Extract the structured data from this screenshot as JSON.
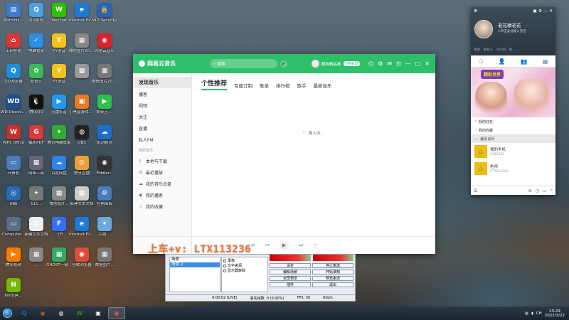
{
  "desktop": {
    "icons": [
      {
        "label": "Adminis...",
        "glyph": "▤",
        "color": "#3d7ac9"
      },
      {
        "label": "QQ游戏",
        "glyph": "Q",
        "color": "#4aa0e0"
      },
      {
        "label": "WeChat",
        "glyph": "W",
        "color": "#2dc100"
      },
      {
        "label": "Internet Explorer",
        "glyph": "e",
        "color": "#1f7ad6"
      },
      {
        "label": "WD Security",
        "glyph": "🔒",
        "color": "#2a65b5"
      },
      {
        "label": "上网导航",
        "glyph": "⌂",
        "color": "#d93636"
      },
      {
        "label": "电脑管家",
        "glyph": "✓",
        "color": "#2a8ee8"
      },
      {
        "label": "YY语音",
        "glyph": "Y",
        "color": "#f4c21c"
      },
      {
        "label": "微信图片20210...",
        "glyph": "▦",
        "color": "#888"
      },
      {
        "label": "网易云音乐",
        "glyph": "◉",
        "color": "#d9232b"
      },
      {
        "label": "QQ浏览器",
        "glyph": "Q",
        "color": "#1e8ed8"
      },
      {
        "label": "爱奇艺",
        "glyph": "✿",
        "color": "#3cba54"
      },
      {
        "label": "YY语音",
        "glyph": "Y",
        "color": "#f4c21c"
      },
      {
        "label": "...",
        "glyph": "▦",
        "color": "#999"
      },
      {
        "label": "微信图片2021...",
        "glyph": "▦",
        "color": "#777"
      },
      {
        "label": "WD Discovery",
        "glyph": "WD",
        "color": "#1f4f8e"
      },
      {
        "label": "腾讯QQ",
        "glyph": "🐧",
        "color": "#111"
      },
      {
        "label": "迅雷影音",
        "glyph": "▶",
        "color": "#2196f3"
      },
      {
        "label": "小黑盒游戏助手",
        "glyph": "▣",
        "color": "#e87a22"
      },
      {
        "label": "爱奇艺 ...",
        "glyph": "▶",
        "color": "#2fc04f"
      },
      {
        "label": "WPS Office",
        "glyph": "W",
        "color": "#c5322d"
      },
      {
        "label": "福昕PDF",
        "glyph": "G",
        "color": "#d83b3b"
      },
      {
        "label": "腾讯电脑管家",
        "glyph": "✦",
        "color": "#3a3"
      },
      {
        "label": "OBS",
        "glyph": "◍",
        "color": "#222"
      },
      {
        "label": "驱动精灵",
        "glyph": "☁",
        "color": "#1d6fcf"
      },
      {
        "label": "计算机",
        "glyph": "▭",
        "color": "#4b7bb8"
      },
      {
        "label": "网络工具",
        "glyph": "▦",
        "color": "#667"
      },
      {
        "label": "百度网盘",
        "glyph": "☁",
        "color": "#2f83e4"
      },
      {
        "label": "虎牙直播",
        "glyph": "◎",
        "color": "#e9a03a"
      },
      {
        "label": "Fiddler...",
        "glyph": "◉",
        "color": "#333"
      },
      {
        "label": "网络",
        "glyph": "◎",
        "color": "#2b6ab5"
      },
      {
        "label": "111...",
        "glyph": "✦",
        "color": "#777"
      },
      {
        "label": "微信图片...",
        "glyph": "▦",
        "color": "#888"
      },
      {
        "label": "新建文本文档",
        "glyph": "▦",
        "color": "#ccc"
      },
      {
        "label": "控制面板",
        "glyph": "⚙",
        "color": "#4b7bb8"
      },
      {
        "label": "Computer...",
        "glyph": "▭",
        "color": "#5a6d86"
      },
      {
        "label": "新建文本文档",
        "glyph": "▤",
        "color": "#eee"
      },
      {
        "label": "飞书",
        "glyph": "F",
        "color": "#3370ff"
      },
      {
        "label": "Internet Explorer",
        "glyph": "e",
        "color": "#1f7ad6"
      },
      {
        "label": "百度...",
        "glyph": "✦",
        "color": "#6fa8dc"
      },
      {
        "label": "腾讯视频",
        "glyph": "▶",
        "color": "#ff7a00"
      },
      {
        "label": "...",
        "glyph": "▦",
        "color": "#888"
      },
      {
        "label": "GHOST一键...",
        "glyph": "▦",
        "color": "#3a6"
      },
      {
        "label": "谷歌浏览器",
        "glyph": "◉",
        "color": "#dd4b39"
      },
      {
        "label": "微信图片...",
        "glyph": "▦",
        "color": "#777"
      },
      {
        "label": "NVIDIA...",
        "glyph": "N",
        "color": "#76b900"
      }
    ]
  },
  "netease": {
    "logo": "网易云音乐",
    "search_placeholder": "搜索",
    "user_name": "酷狗精品推",
    "vip_label": "VIP会员",
    "controls": [
      "⌬",
      "⚙",
      "✉",
      "⊡",
      "—",
      "□",
      "✕"
    ],
    "sidebar": {
      "main_items": [
        "发现音乐",
        "播客",
        "视频",
        "关注",
        "直播",
        "私人FM"
      ],
      "section_head": "我的音乐",
      "my_items": [
        {
          "icon": "⇩",
          "label": "本地与下载"
        },
        {
          "icon": "◷",
          "label": "最近播放"
        },
        {
          "icon": "☁",
          "label": "我的音乐云盘"
        },
        {
          "icon": "◉",
          "label": "我的播客"
        },
        {
          "icon": "☆",
          "label": "我的收藏"
        }
      ]
    },
    "tabs": [
      "个性推荐",
      "专属订制",
      "歌单",
      "排行榜",
      "歌手",
      "最新音乐"
    ],
    "loading_text": "载入中...",
    "player": [
      "⇄",
      "⏮",
      "▶",
      "⏭",
      "◻"
    ]
  },
  "watermark": "上车+v: LTX113236",
  "obs": {
    "scenes": [
      "场景",
      "场景 2"
    ],
    "sources": [
      "录像",
      "文字来源",
      "显示器获取"
    ],
    "buttons": [
      "设定",
      "停止串流",
      "编辑场景",
      "开始录制",
      "全屏预览",
      "预览串流",
      "插件",
      "退出"
    ],
    "status": [
      "0:00:02 (LIVE)",
      "丢失帧数: 0 (0.00%)",
      "FPS: 30",
      "0kb/s"
    ]
  },
  "qq": {
    "window_controls": [
      "▣",
      "⚙",
      "—",
      "✕"
    ],
    "name": "老花精老花",
    "signature": "≈单击此处输入签名",
    "search_hint": "搜索：联系人、讨论组、群、...",
    "tabs": [
      "☖",
      "👤",
      "👥",
      "▦"
    ],
    "banner_badge": "精彩世界",
    "groups": [
      "我的好友",
      "我的收藏",
      "最近访问"
    ],
    "contacts": [
      {
        "name": "我的手机",
        "status": "2145230",
        "glyph": "⌂"
      },
      {
        "name": "老师",
        "status": "277011300",
        "glyph": "⌂"
      }
    ],
    "bottom_icons": [
      "☰",
      "⊕",
      "◷",
      "▭",
      "⌕"
    ]
  },
  "taskbar": {
    "apps": [
      "Q",
      "◉",
      "◍",
      "W",
      "▣",
      "◉"
    ],
    "tray_text": "CH",
    "time": "23:29",
    "date": "2022/3/22"
  }
}
